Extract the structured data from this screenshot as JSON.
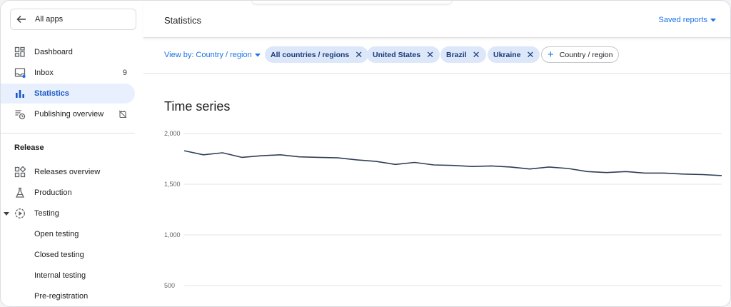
{
  "sidebar": {
    "all_apps": "All apps",
    "items": [
      {
        "label": "Dashboard",
        "icon": "dashboard-icon"
      },
      {
        "label": "Inbox",
        "icon": "inbox-icon",
        "badge": "9"
      },
      {
        "label": "Statistics",
        "icon": "bar-chart-icon",
        "active": true
      },
      {
        "label": "Publishing overview",
        "icon": "publishing-icon"
      }
    ],
    "section": "Release",
    "release_items": [
      {
        "label": "Releases overview",
        "icon": "grid-icon"
      },
      {
        "label": "Production",
        "icon": "flask-icon"
      },
      {
        "label": "Testing",
        "icon": "play-circle-icon"
      }
    ],
    "testing_sub": [
      "Open testing",
      "Closed testing",
      "Internal testing",
      "Pre-registration"
    ]
  },
  "header": {
    "title": "Statistics",
    "saved_reports": "Saved reports"
  },
  "filters": {
    "view_by": "View by: Country / region",
    "chips": [
      "All countries / regions",
      "United States",
      "Brazil",
      "Ukraine"
    ],
    "add_chip": "Country / region"
  },
  "chart_section": {
    "title": "Time series"
  },
  "colors": {
    "accent": "#1a73e8",
    "active_bg": "#e8f0fe",
    "chip_bg": "#dce7f9",
    "line": "#2f3e56"
  },
  "chart_data": {
    "type": "line",
    "title": "",
    "xlabel": "",
    "ylabel": "",
    "ylim": [
      500,
      2000
    ],
    "yticks": [
      500,
      1000,
      1500,
      2000
    ],
    "ytick_labels": [
      "500",
      "1,000",
      "1,500",
      "2,000"
    ],
    "grid": true,
    "series": [
      {
        "values": [
          1830,
          1790,
          1810,
          1765,
          1780,
          1790,
          1770,
          1765,
          1760,
          1740,
          1725,
          1695,
          1715,
          1690,
          1685,
          1675,
          1680,
          1670,
          1650,
          1670,
          1655,
          1625,
          1615,
          1625,
          1610,
          1610,
          1600,
          1595,
          1585
        ]
      }
    ]
  }
}
